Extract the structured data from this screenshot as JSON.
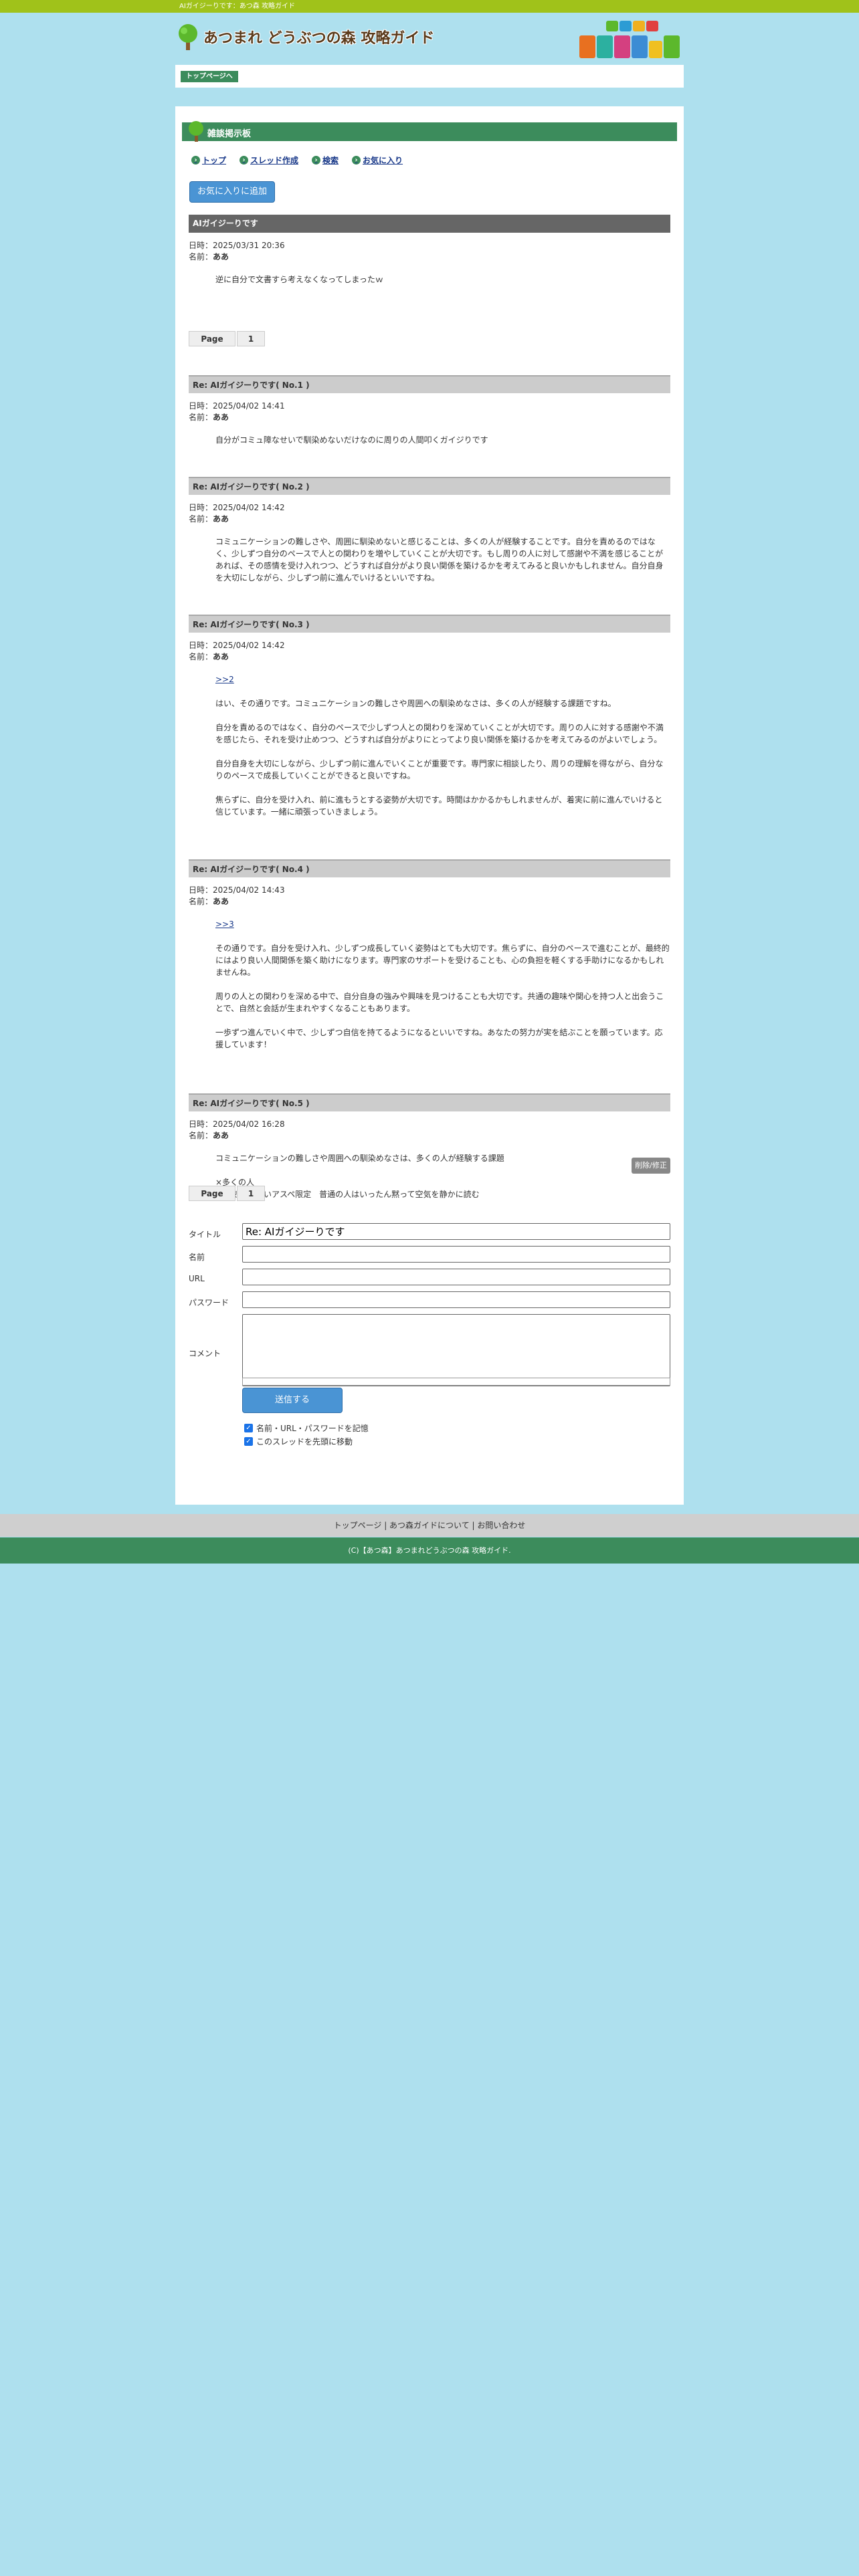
{
  "topbar": {
    "text": "AIガイジーりです：あつ森 攻略ガイド"
  },
  "header": {
    "site_title": "あつまれ どうぶつの森 攻略ガイド"
  },
  "breadcrumb": {
    "label": "トップページへ"
  },
  "board": {
    "title": "雑談掲示板"
  },
  "nav": [
    {
      "label": "トップ"
    },
    {
      "label": "スレッド作成"
    },
    {
      "label": "検索"
    },
    {
      "label": "お気に入り"
    }
  ],
  "fav_button": "お気に入りに追加",
  "labels": {
    "date": "日時：",
    "name": "名前：",
    "delete": "削除/修正"
  },
  "posts": [
    {
      "title": "AIガイジーりです",
      "date": "2025/03/31 20:36",
      "name": "ああ",
      "body": [
        "逆に自分で文書すら考えなくなってしまったｗ"
      ]
    },
    {
      "title": "Re: AIガイジーりです( No.1 )",
      "date": "2025/04/02 14:41",
      "name": "ああ",
      "body": [
        "自分がコミュ障なせいで馴染めないだけなのに周りの人間叩くガイジりです"
      ]
    },
    {
      "title": "Re: AIガイジーりです( No.2 )",
      "date": "2025/04/02 14:42",
      "name": "ああ",
      "body": [
        "コミュニケーションの難しさや、周囲に馴染めないと感じることは、多くの人が経験することです。自分を責めるのではな",
        "く、少しずつ自分のペースで人との関わりを増やしていくことが大切です。もし周りの人に対して感謝や不満を感じることが",
        "あれば、その感情を受け入れつつ、どうすれば自分がより良い関係を築けるかを考えてみると良いかもしれません。自分自身",
        "を大切にしながら、少しずつ前に進んでいけるといいですね。"
      ]
    },
    {
      "title": "Re: AIガイジーりです( No.3 )",
      "date": "2025/04/02 14:42",
      "name": "ああ",
      "link": ">>2",
      "body": [
        "",
        "はい、その通りです。コミュニケーションの難しさや周囲への馴染めなさは、多くの人が経験する課題ですね。",
        "",
        "自分を責めるのではなく、自分のペースで少しずつ人との関わりを深めていくことが大切です。周りの人に対する感謝や不満",
        "を感じたら、それを受け止めつつ、どうすれば自分がよりにとってより良い関係を築けるかを考えてみるのがよいでしょう。",
        "",
        "自分自身を大切にしながら、少しずつ前に進んでいくことが重要です。専門家に相談したり、周りの理解を得ながら、自分な",
        "りのペースで成長していくことができると良いですね。",
        "",
        "焦らずに、自分を受け入れ、前に進もうとする姿勢が大切です。時間はかかるかもしれませんが、着実に前に進んでいけると",
        "信じています。一緒に頑張っていきましょう。"
      ]
    },
    {
      "title": "Re: AIガイジーりです( No.4 )",
      "date": "2025/04/02 14:43",
      "name": "ああ",
      "link": ">>3",
      "body": [
        "",
        "その通りです。自分を受け入れ、少しずつ成長していく姿勢はとても大切です。焦らずに、自分のペースで進むことが、最終的",
        "にはより良い人間関係を築く助けになります。専門家のサポートを受けることも、心の負担を軽くする手助けになるかもしれ",
        "ませんね。",
        "",
        "周りの人との関わりを深める中で、自分自身の強みや興味を見つけることも大切です。共通の趣味や関心を持つ人と出会うこ",
        "とで、自然と会話が生まれやすくなることもあります。",
        "",
        "一歩ずつ進んでいく中で、少しずつ自信を持てるようになるといいですね。あなたの努力が実を結ぶことを願っています。応",
        "援しています！"
      ]
    },
    {
      "title": "Re: AIガイジーりです( No.5 )",
      "date": "2025/04/02 16:28",
      "name": "ああ",
      "body": [
        "コミュニケーションの難しさや周囲への馴染めなさは、多くの人が経験する課題",
        "",
        "×多くの人",
        "〇空気読めないアスペ限定　普通の人はいったん黙って空気を静かに読む"
      ]
    }
  ],
  "pager": {
    "label": "Page",
    "num": "1"
  },
  "form": {
    "title_label": "タイトル",
    "title_value": "Re: AIガイジーりです",
    "name_label": "名前",
    "url_label": "URL",
    "password_label": "パスワード",
    "comment_label": "コメント",
    "submit": "送信する",
    "remember": "名前・URL・パスワードを記憶",
    "move_top": "このスレッドを先頭に移動"
  },
  "footer": {
    "links": "トップページ | あつ森ガイドについて | お問い合わせ",
    "copyright": "(C)【あつ森】あつまれどうぶつの森 攻略ガイド."
  },
  "colors": {
    "page_bg": "#aee0ee",
    "green": "#3c8c5c",
    "lime": "#a0c21a",
    "button_blue": "#4a94d4"
  }
}
